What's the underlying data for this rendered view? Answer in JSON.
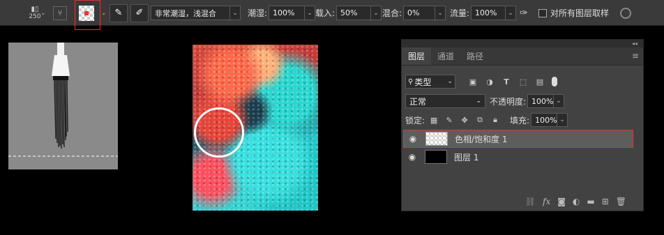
{
  "toolbar": {
    "brush_size": "250",
    "mode": "非常潮湿，浅混合",
    "wet_label": "潮湿:",
    "wet_value": "100%",
    "load_label": "载入:",
    "load_value": "50%",
    "mix_label": "混合:",
    "mix_value": "0%",
    "flow_label": "流量:",
    "flow_value": "100%",
    "sample_all_label": "对所有图层取样"
  },
  "layers_panel": {
    "tabs": [
      "图层",
      "通道",
      "路径"
    ],
    "filter_kind": "类型",
    "blend_mode": "正常",
    "opacity_label": "不透明度:",
    "opacity_value": "100%",
    "lock_label": "锁定:",
    "fill_label": "填充:",
    "fill_value": "100%",
    "layers": [
      {
        "name": "色相/饱和度 1",
        "selected": true
      },
      {
        "name": "图层 1",
        "selected": false
      }
    ],
    "footer_icons": [
      "link-icon",
      "fx-icon",
      "mask-icon",
      "adjustment-icon",
      "folder-icon",
      "new-layer-icon",
      "trash-icon"
    ]
  },
  "colors": {
    "highlight": "#e23333",
    "panel_bg": "#424242"
  }
}
